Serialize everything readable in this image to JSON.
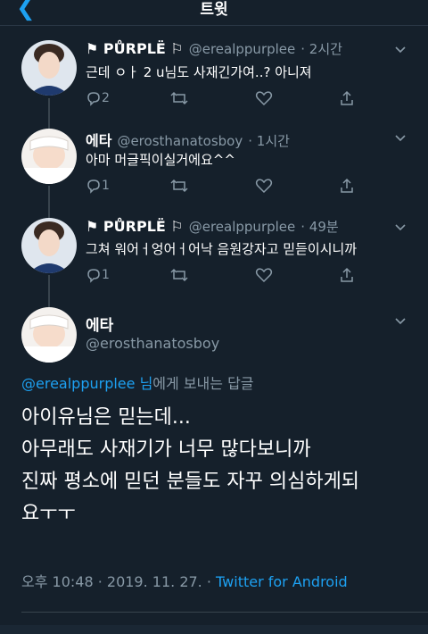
{
  "header": {
    "back_icon": "chevron-left-icon",
    "title": "트윗"
  },
  "tweets": [
    {
      "display_name": "PŮRPLË",
      "handle": "@erealppurplee",
      "time": "· 2시간",
      "text": "근데 ㅇㅏ 2 u님도 사재긴가여..? 아니져",
      "reply_count": "2",
      "avatar": "avatar-photo"
    },
    {
      "display_name": "에타",
      "handle": "@erosthanatosboy",
      "time": "· 1시간",
      "text": "아마 머글픽이실거에요^^",
      "reply_count": "1",
      "avatar": "avatar-photo"
    },
    {
      "display_name": "PŮRPLË",
      "handle": "@erealppurplee",
      "time": "· 49분",
      "text": "그쳐 워어ㅓ엉어ㅓ어낙 음원강자고 믿듣이시니까",
      "reply_count": "1",
      "avatar": "avatar-photo"
    }
  ],
  "focus": {
    "display_name": "에타",
    "handle": "@erosthanatosboy",
    "replying_mention": "@erealppurplee 님",
    "replying_suffix": "에게 보내는 답글",
    "lines": [
      "아이유님은 믿는데...",
      "아무래도 사재기가 너무 많다보니까",
      "진짜 평소에 믿던 분들도 자꾸 의심하게되",
      "요ㅜㅜ"
    ],
    "time": "오후 10:48 · 2019. 11. 27. · ",
    "source": "Twitter for Android"
  },
  "colors": {
    "background": "#15202b",
    "accent": "#1da1f2",
    "muted": "#8899a6"
  }
}
